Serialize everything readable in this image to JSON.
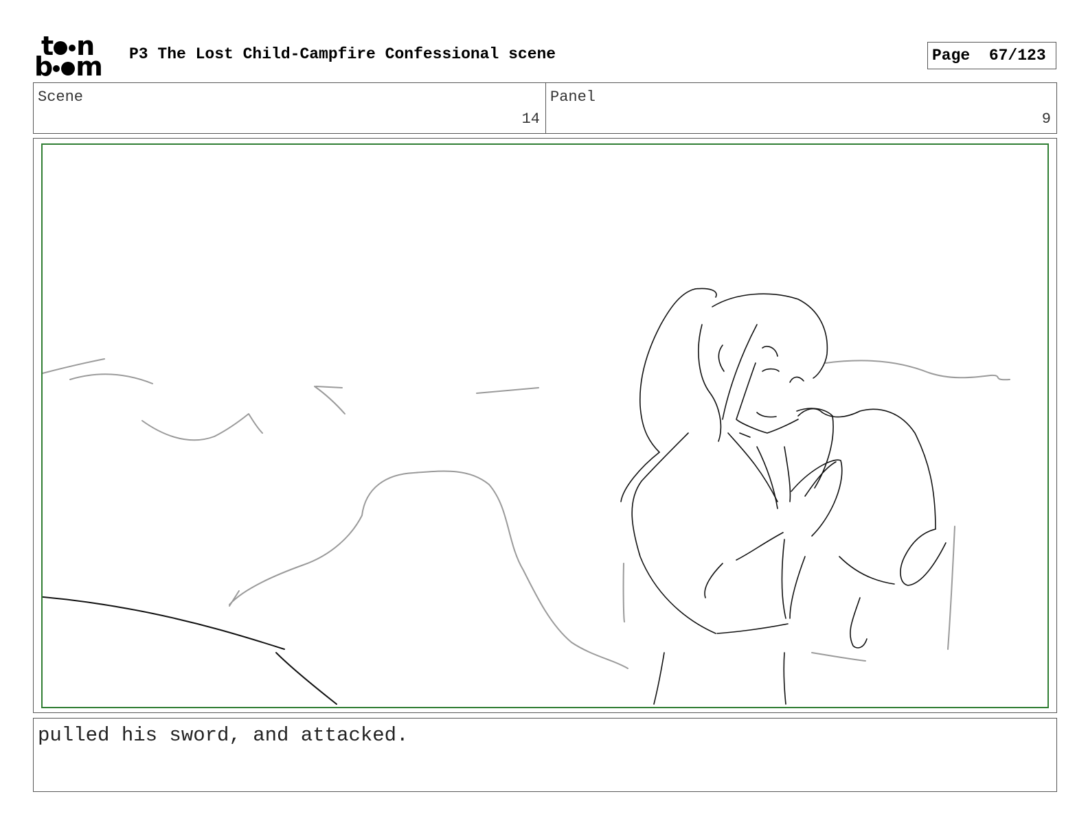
{
  "header": {
    "logo_text_top": "t",
    "logo_text_top_end": "n",
    "logo_text_bottom_start": "b",
    "logo_text_bottom_end": "m",
    "title": "P3 The Lost Child-Campfire Confessional scene",
    "page_label": "Page",
    "page_value": "67/123"
  },
  "info": {
    "scene_label": "Scene",
    "scene_value": "14",
    "panel_label": "Panel",
    "panel_value": "9"
  },
  "frame": {
    "border_color": "#2f7d32",
    "sketch_dark": "#111111",
    "sketch_light": "#9a9a9a"
  },
  "caption": {
    "text": "pulled his sword, and attacked."
  }
}
